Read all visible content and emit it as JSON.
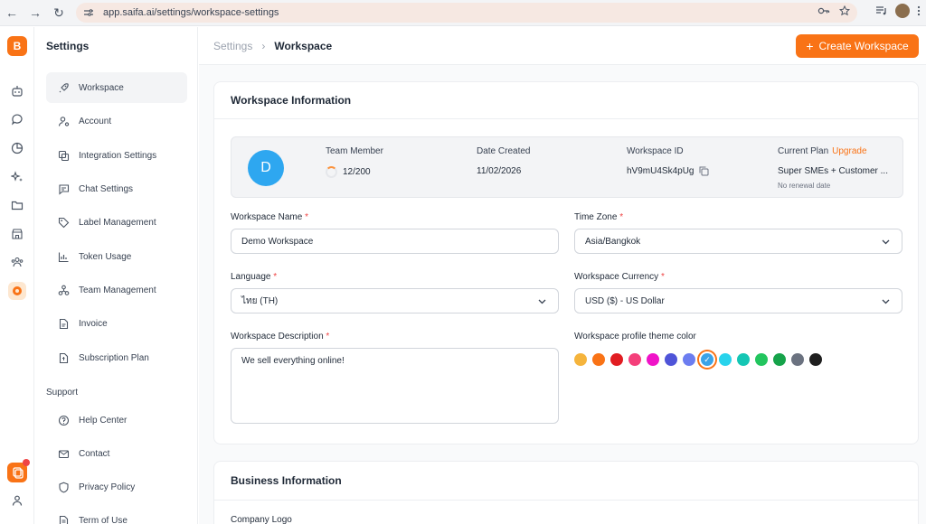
{
  "browser": {
    "url": "app.saifa.ai/settings/workspace-settings",
    "back_icon": "←",
    "forward_icon": "→",
    "reload_icon": "↻"
  },
  "rail": {
    "logo": "B"
  },
  "sidebar": {
    "title": "Settings",
    "items": [
      {
        "label": "Workspace",
        "icon": "rocket-icon"
      },
      {
        "label": "Account",
        "icon": "user-gear-icon"
      },
      {
        "label": "Integration Settings",
        "icon": "integration-icon"
      },
      {
        "label": "Chat Settings",
        "icon": "chat-icon"
      },
      {
        "label": "Label Management",
        "icon": "tag-icon"
      },
      {
        "label": "Token Usage",
        "icon": "chart-icon"
      },
      {
        "label": "Team Management",
        "icon": "team-icon"
      },
      {
        "label": "Invoice",
        "icon": "invoice-icon"
      },
      {
        "label": "Subscription Plan",
        "icon": "subscription-icon"
      }
    ],
    "support_title": "Support",
    "support_items": [
      {
        "label": "Help Center",
        "icon": "help-icon"
      },
      {
        "label": "Contact",
        "icon": "mail-icon"
      },
      {
        "label": "Privacy Policy",
        "icon": "shield-icon"
      },
      {
        "label": "Term of Use",
        "icon": "document-icon"
      }
    ]
  },
  "header": {
    "breadcrumb_parent": "Settings",
    "breadcrumb_sep": "›",
    "breadcrumb_current": "Workspace",
    "create_button": "Create Workspace",
    "create_icon": "+"
  },
  "workspace_info": {
    "title": "Workspace Information",
    "avatar_letter": "D",
    "team_member_label": "Team Member",
    "team_member_value": "12/200",
    "date_created_label": "Date Created",
    "date_created_value": "11/02/2026",
    "workspace_id_label": "Workspace ID",
    "workspace_id_value": "hV9mU4Sk4pUg",
    "current_plan_label": "Current Plan",
    "upgrade_label": "Upgrade",
    "current_plan_value": "Super SMEs + Customer ...",
    "renewal_text": "No renewal date"
  },
  "form": {
    "name_label": "Workspace Name",
    "name_value": "Demo Workspace",
    "timezone_label": "Time Zone",
    "timezone_value": "Asia/Bangkok",
    "language_label": "Language",
    "language_value": "ไทย (TH)",
    "currency_label": "Workspace Currency",
    "currency_value": "USD ($) - US Dollar",
    "description_label": "Workspace Description",
    "description_value": "We sell everything online!",
    "theme_label": "Workspace profile theme color",
    "required_mark": "*",
    "theme_colors": [
      "#f5b43c",
      "#f97316",
      "#e11d22",
      "#f43f7a",
      "#f013c8",
      "#4f54d8",
      "#6c7df0",
      "#3ba3e8",
      "#28d3ec",
      "#14c6b4",
      "#22c55e",
      "#16a34a",
      "#6b7280",
      "#1f1f1f"
    ],
    "theme_selected_index": 7
  },
  "business_info": {
    "title": "Business Information",
    "logo_label": "Company Logo"
  }
}
